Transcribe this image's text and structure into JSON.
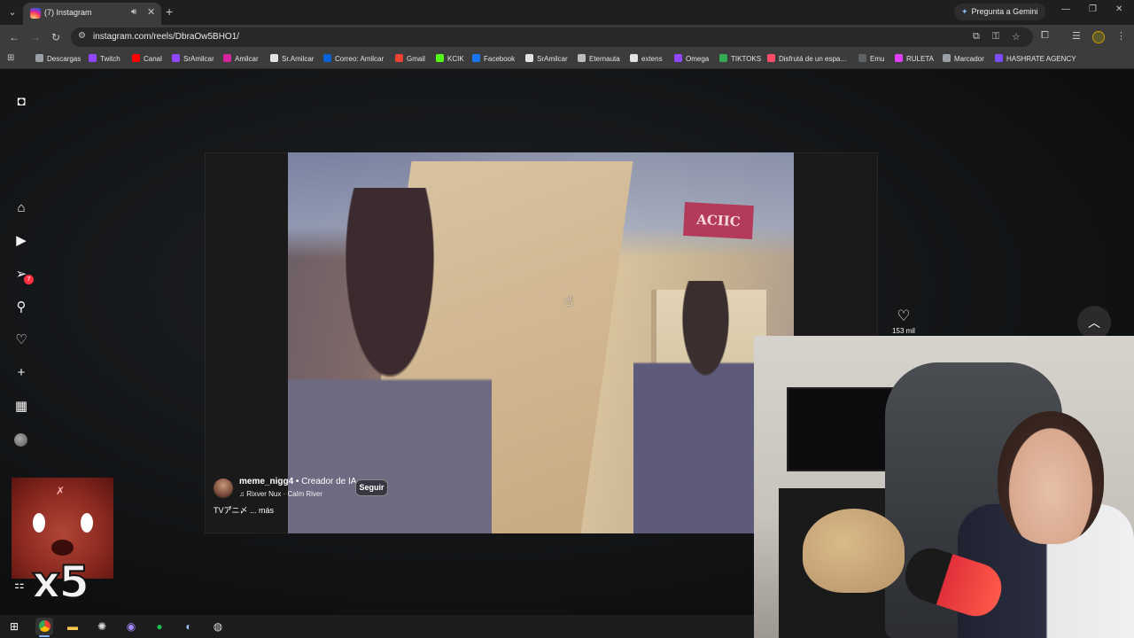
{
  "browser": {
    "tab_title": "(7) Instagram",
    "tab_menu_icon": "chevron-down-icon",
    "tab_audio_icon": "speaker-icon",
    "tab_close": "✕",
    "new_tab": "+",
    "gemini_label": "Pregunta a Gemini",
    "url": "instagram.com/reels/DbraOw5BHO1/",
    "window_controls": [
      "—",
      "❐",
      "✕"
    ]
  },
  "bookmarks": [
    {
      "label": "Descargas",
      "color": "#9aa0a6"
    },
    {
      "label": "Twitch",
      "color": "#9146ff"
    },
    {
      "label": "Canal",
      "color": "#ff0000"
    },
    {
      "label": "SrAmilcar",
      "color": "#9146ff"
    },
    {
      "label": "Amilcar",
      "color": "#d6249f"
    },
    {
      "label": "Sr.Amilcar",
      "color": "#e3e3e3"
    },
    {
      "label": "Correo: Amilcar",
      "color": "#0a64d6"
    },
    {
      "label": "Gmail",
      "color": "#ea4335"
    },
    {
      "label": "KCIK",
      "color": "#53fc18"
    },
    {
      "label": "Facebook",
      "color": "#1877f2"
    },
    {
      "label": "SrAmilcar",
      "color": "#e3e3e3"
    },
    {
      "label": "Eternauta",
      "color": "#bdbdbd"
    },
    {
      "label": "extens",
      "color": "#e3e3e3"
    },
    {
      "label": "Omega",
      "color": "#9146ff"
    },
    {
      "label": "TIKTOKS",
      "color": "#34a853"
    },
    {
      "label": "Disfrutá de un espa...",
      "color": "#ff4d6d"
    },
    {
      "label": "Emu",
      "color": "#5f6368"
    },
    {
      "label": "RULETA",
      "color": "#e040fb"
    },
    {
      "label": "Marcador",
      "color": "#9aa0a6"
    },
    {
      "label": "HASHRATE AGENCY",
      "color": "#7c4dff"
    }
  ],
  "instagram": {
    "notification_count": "7",
    "creator": {
      "username": "meme_nigg4",
      "separator": " • ",
      "role": "Creador de IA",
      "music": "♫ Rixver Nux · Calm River",
      "follow_label": "Seguir",
      "caption": "TVア゙ニ〆 ... más"
    },
    "video_sign_text": "ACIIC",
    "likes": "153 mil",
    "scroll_up_icon": "chevron-up-icon"
  },
  "overlay": {
    "multiplier": "x5"
  },
  "taskbar": {
    "items": [
      "windows-start",
      "chrome",
      "file-explorer",
      "app-3",
      "discord",
      "spotify",
      "steam",
      "app-7"
    ]
  }
}
